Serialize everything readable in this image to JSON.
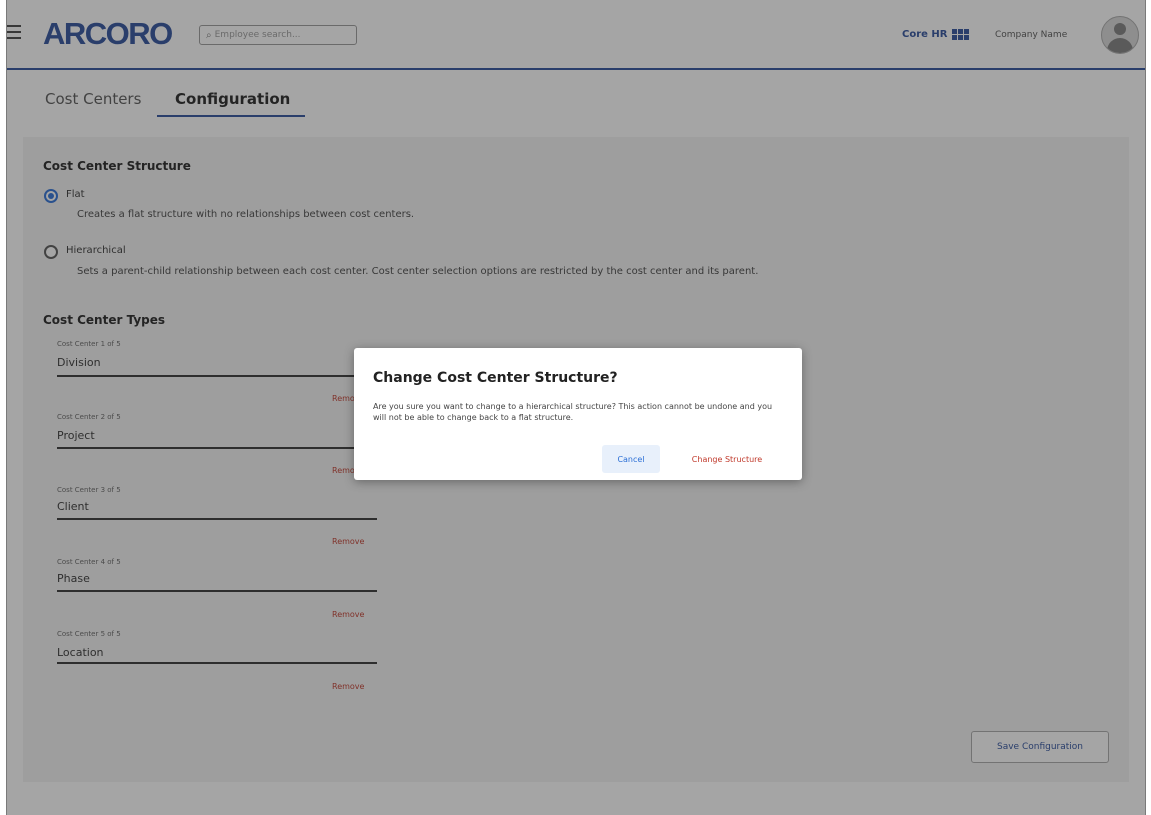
{
  "header": {
    "logo": "ARCORO",
    "search_placeholder": "Employee search...",
    "product": "Core HR",
    "company": "Company Name"
  },
  "tabs": [
    {
      "label": "Cost Centers",
      "active": false
    },
    {
      "label": "Configuration",
      "active": true
    }
  ],
  "structure": {
    "title": "Cost Center Structure",
    "options": [
      {
        "label": "Flat",
        "desc": "Creates a flat structure with no relationships between cost centers.",
        "checked": true
      },
      {
        "label": "Hierarchical",
        "desc": "Sets a parent-child relationship between each cost center. Cost center selection options are restricted by the cost center and its parent.",
        "checked": false
      }
    ]
  },
  "types": {
    "title": "Cost Center Types",
    "items": [
      {
        "caption": "Cost Center 1 of 5",
        "value": "Division",
        "remove": "Remove"
      },
      {
        "caption": "Cost Center 2 of 5",
        "value": "Project",
        "remove": "Remove"
      },
      {
        "caption": "Cost Center 3 of 5",
        "value": "Client",
        "remove": "Remove"
      },
      {
        "caption": "Cost Center 4 of 5",
        "value": "Phase",
        "remove": "Remove"
      },
      {
        "caption": "Cost Center 5 of 5",
        "value": "Location",
        "remove": "Remove"
      }
    ]
  },
  "save_label": "Save Configuration",
  "modal": {
    "title": "Change Cost Center Structure?",
    "body": "Are you sure you want to change to a hierarchical structure? This action cannot be undone and you will not be able to change back to a flat structure.",
    "cancel": "Cancel",
    "confirm": "Change Structure"
  },
  "colors": {
    "brand": "#2b4e9c",
    "accent": "#2b6fd6",
    "danger": "#c0392b"
  }
}
